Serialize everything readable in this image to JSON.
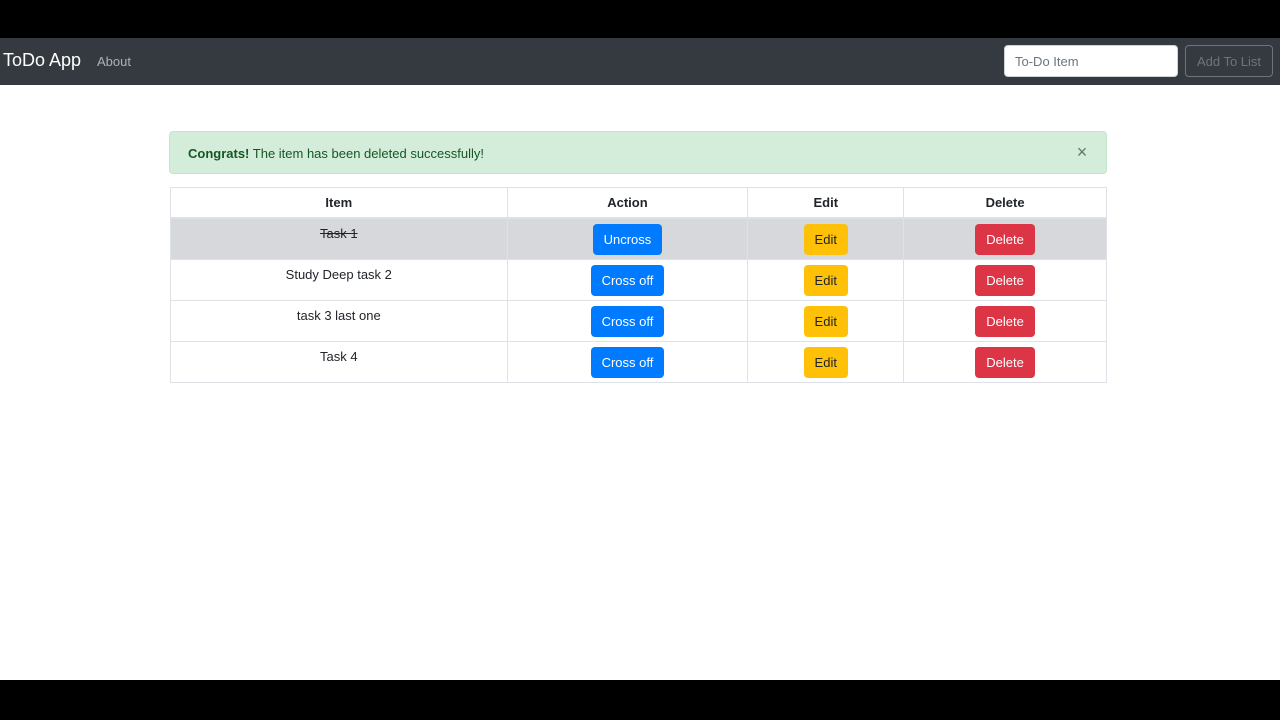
{
  "navbar": {
    "brand": "ToDo App",
    "about_link": "About",
    "input_placeholder": "To-Do Item",
    "input_value": "",
    "add_button": "Add To List"
  },
  "alert": {
    "strong": "Congrats!",
    "message": " The item has been deleted successfully!",
    "close_symbol": "×"
  },
  "table": {
    "headers": [
      "Item",
      "Action",
      "Edit",
      "Delete"
    ],
    "rows": [
      {
        "item": "Task 1",
        "crossed": true,
        "action": "Uncross",
        "edit": "Edit",
        "delete": "Delete"
      },
      {
        "item": "Study Deep task 2",
        "crossed": false,
        "action": "Cross off",
        "edit": "Edit",
        "delete": "Delete"
      },
      {
        "item": "task 3 last one",
        "crossed": false,
        "action": "Cross off",
        "edit": "Edit",
        "delete": "Delete"
      },
      {
        "item": "Task 4",
        "crossed": false,
        "action": "Cross off",
        "edit": "Edit",
        "delete": "Delete"
      }
    ]
  },
  "colors": {
    "navbar_bg": "#343a40",
    "alert_bg": "#d4edda",
    "primary": "#007bff",
    "warning": "#ffc107",
    "danger": "#dc3545",
    "crossed_row_bg": "#d6d8db"
  }
}
